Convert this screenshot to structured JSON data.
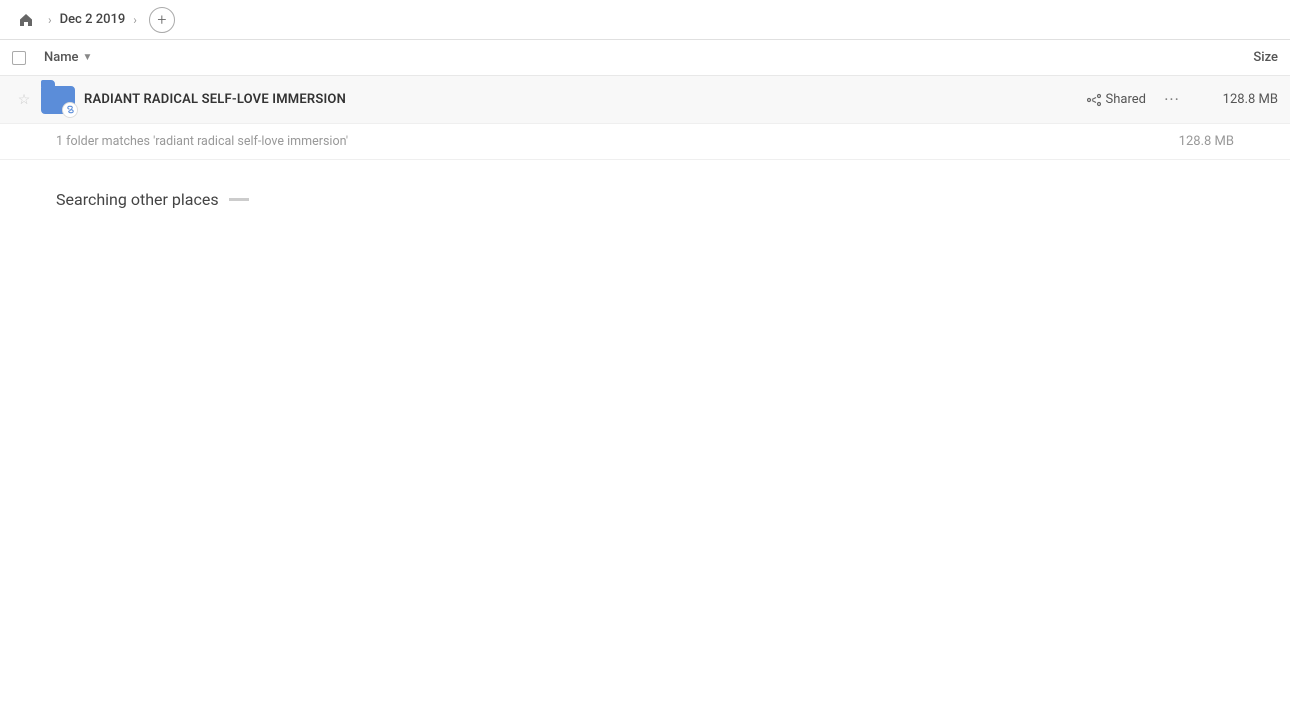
{
  "topbar": {
    "home_icon": "⌂",
    "breadcrumb": "Dec 2 2019",
    "chevron": "›",
    "add_label": "+"
  },
  "column_headers": {
    "name_label": "Name",
    "name_chevron": "▼",
    "size_label": "Size"
  },
  "file_row": {
    "folder_name": "RADIANT RADICAL SELF-LOVE IMMERSION",
    "shared_label": "Shared",
    "file_size": "128.8 MB",
    "more_icon": "···"
  },
  "match_info": {
    "text": "1 folder matches 'radiant radical self-love immersion'",
    "size": "128.8 MB"
  },
  "searching": {
    "title": "Searching other places"
  }
}
